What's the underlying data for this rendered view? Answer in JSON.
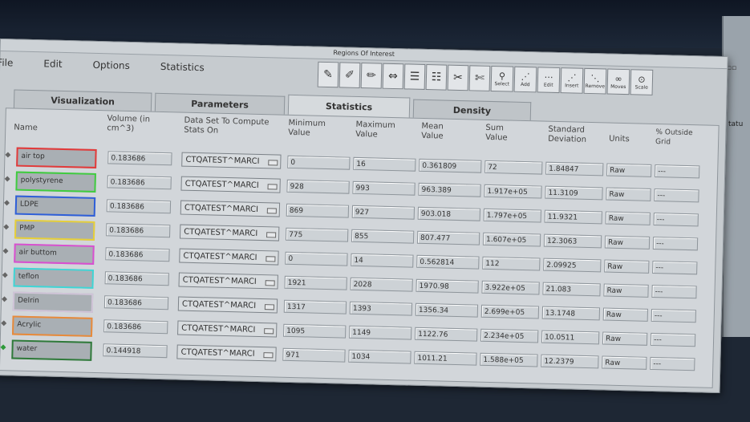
{
  "window": {
    "title": "Regions Of Interest",
    "menus": [
      "File",
      "Edit",
      "Options",
      "Statistics"
    ]
  },
  "toolbar": {
    "labels": [
      "Select",
      "Add",
      "Edit",
      "Insert",
      "Remove",
      "Moves",
      "Scale"
    ]
  },
  "tabs": [
    "Visualization",
    "Parameters",
    "Statistics",
    "Density"
  ],
  "active_tab": "Statistics",
  "headers": {
    "name": "Name",
    "volume": "Volume (in cm^3)",
    "dataset": "Data Set To Compute Stats On",
    "minimum": "Minimum Value",
    "maximum": "Maximum Value",
    "mean": "Mean Value",
    "sum": "Sum Value",
    "stddev": "Standard Deviation",
    "units": "Units",
    "outside": "% Outside Grid"
  },
  "rows": [
    {
      "name": "air top",
      "color": "#e23a3a",
      "volume": "0.183686",
      "dataset": "CTQATEST^MARCI",
      "min": "0",
      "max": "16",
      "mean": "0.361809",
      "sum": "72",
      "std": "1.84847",
      "units": "Raw",
      "outside": "---"
    },
    {
      "name": "polystyrene",
      "color": "#3fcc3f",
      "volume": "0.183686",
      "dataset": "CTQATEST^MARCI",
      "min": "928",
      "max": "993",
      "mean": "963.389",
      "sum": "1.917e+05",
      "std": "11.3109",
      "units": "Raw",
      "outside": "---"
    },
    {
      "name": "LDPE",
      "color": "#2f5fd8",
      "volume": "0.183686",
      "dataset": "CTQATEST^MARCI",
      "min": "869",
      "max": "927",
      "mean": "903.018",
      "sum": "1.797e+05",
      "std": "11.9321",
      "units": "Raw",
      "outside": "---"
    },
    {
      "name": "PMP",
      "color": "#e6cf3a",
      "volume": "0.183686",
      "dataset": "CTQATEST^MARCI",
      "min": "775",
      "max": "855",
      "mean": "807.477",
      "sum": "1.607e+05",
      "std": "12.3063",
      "units": "Raw",
      "outside": "---"
    },
    {
      "name": "air buttom",
      "color": "#d94fd0",
      "volume": "0.183686",
      "dataset": "CTQATEST^MARCI",
      "min": "0",
      "max": "14",
      "mean": "0.562814",
      "sum": "112",
      "std": "2.09925",
      "units": "Raw",
      "outside": "---"
    },
    {
      "name": "teflon",
      "color": "#3fd6d6",
      "volume": "0.183686",
      "dataset": "CTQATEST^MARCI",
      "min": "1921",
      "max": "2028",
      "mean": "1970.98",
      "sum": "3.922e+05",
      "std": "21.083",
      "units": "Raw",
      "outside": "---"
    },
    {
      "name": "Delrin",
      "color": "#d0c4d8",
      "volume": "0.183686",
      "dataset": "CTQATEST^MARCI",
      "min": "1317",
      "max": "1393",
      "mean": "1356.34",
      "sum": "2.699e+05",
      "std": "13.1748",
      "units": "Raw",
      "outside": "---"
    },
    {
      "name": "Acrylic",
      "color": "#e88a3a",
      "volume": "0.183686",
      "dataset": "CTQATEST^MARCI",
      "min": "1095",
      "max": "1149",
      "mean": "1122.76",
      "sum": "2.234e+05",
      "std": "10.0511",
      "units": "Raw",
      "outside": "---"
    },
    {
      "name": "water",
      "color": "#2f7a3a",
      "volume": "0.144918",
      "dataset": "CTQATEST^MARCI",
      "min": "971",
      "max": "1034",
      "mean": "1011.21",
      "sum": "1.588e+05",
      "std": "12.2379",
      "units": "Raw",
      "outside": "---"
    }
  ]
}
